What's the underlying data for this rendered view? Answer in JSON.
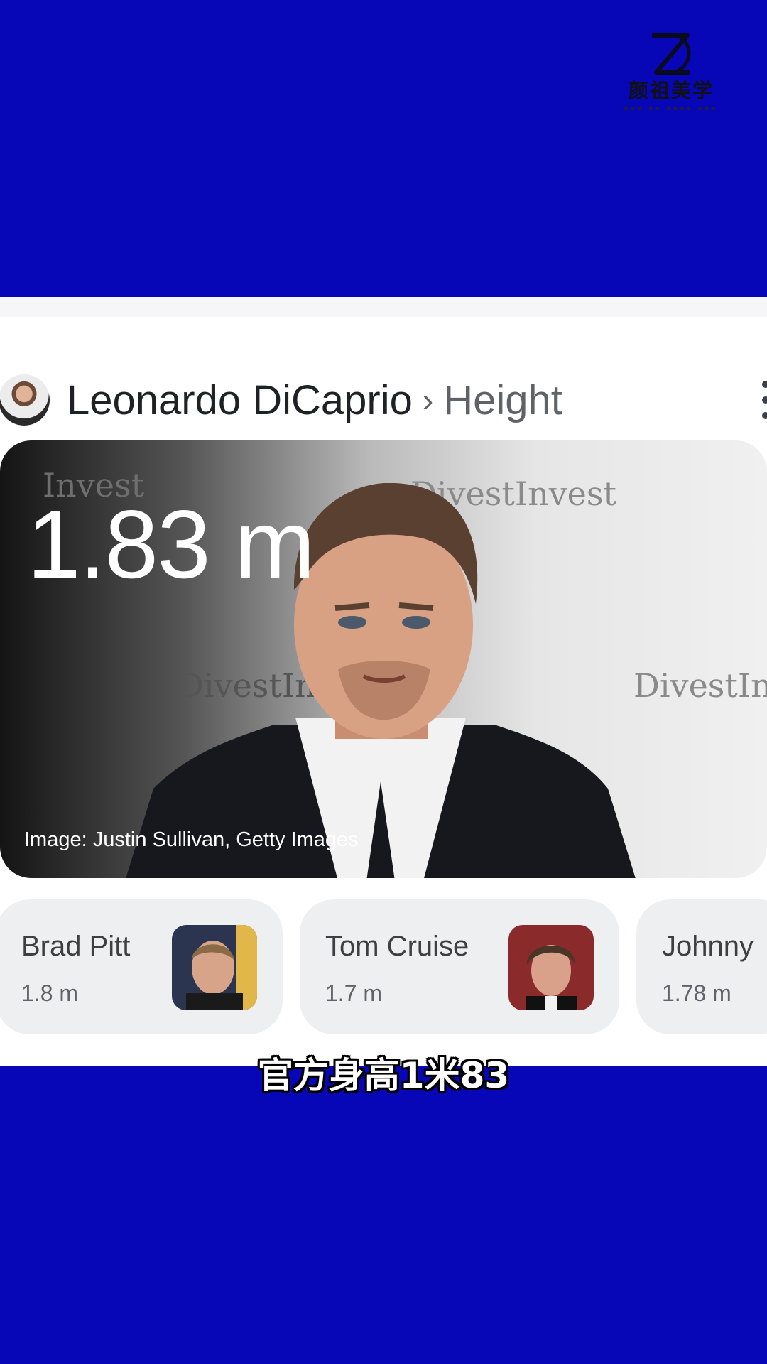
{
  "brand": {
    "logo_icon": "zx-monogram-icon",
    "name": "颜祖美学"
  },
  "header": {
    "subject": "Leonardo DiCaprio",
    "separator": "›",
    "attribute": "Height",
    "avatar_icon": "profile-photo"
  },
  "hero": {
    "value": "1.83 m",
    "credit": "Image: Justin Sullivan, Getty Images",
    "backdrop_words": [
      "Invest",
      "DivestInvest",
      "DivestIn",
      "DivestIn"
    ]
  },
  "related": [
    {
      "name": "Brad Pitt",
      "height": "1.8 m"
    },
    {
      "name": "Tom Cruise",
      "height": "1.7 m"
    },
    {
      "name": "Johnny",
      "height": "1.78 m"
    }
  ],
  "caption": "官方身高1米83",
  "colors": {
    "background_blue": "#0707b8",
    "card_white": "#ffffff",
    "chip_gray": "#eeeff1"
  }
}
